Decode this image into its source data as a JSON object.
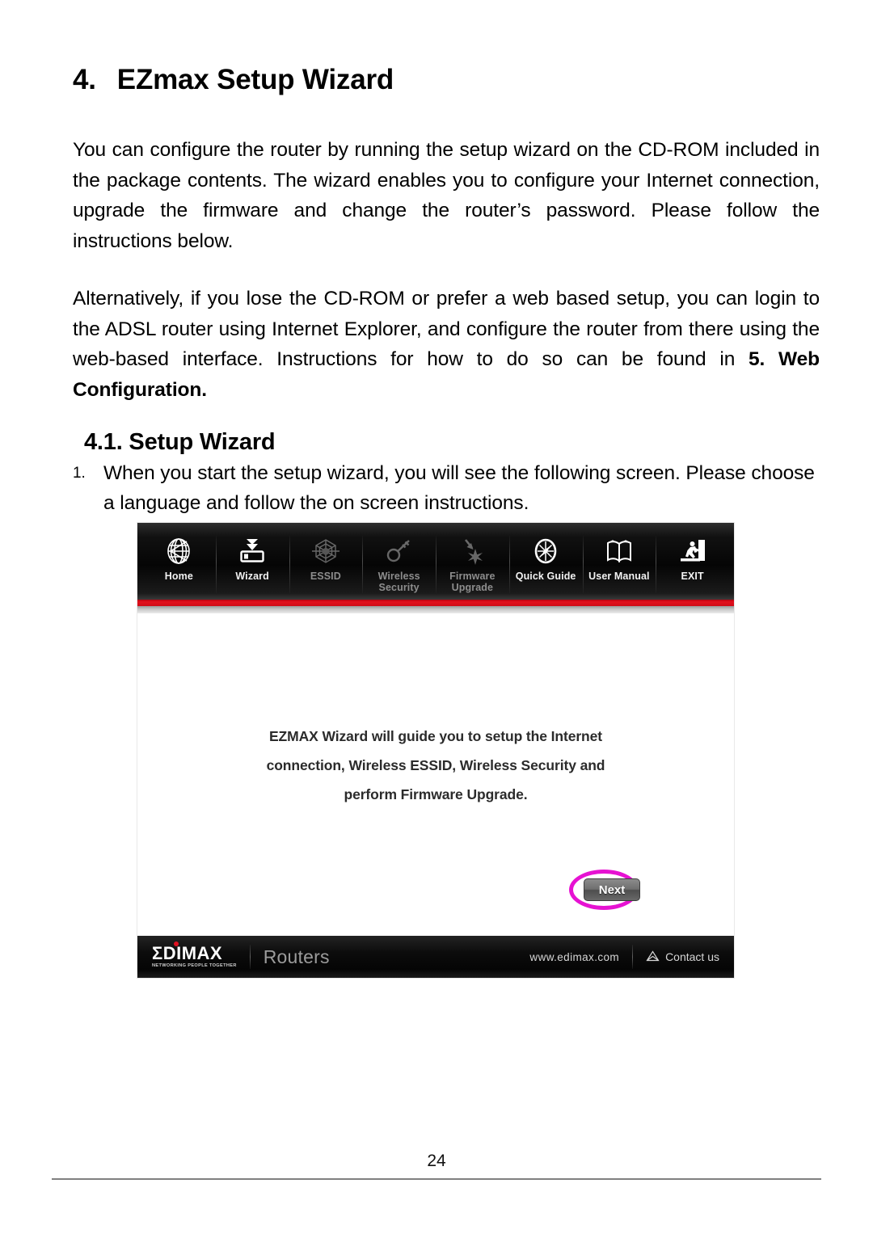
{
  "document": {
    "heading": {
      "number": "4.",
      "text": "EZmax Setup Wizard"
    },
    "paragraph_1": "You can configure the router by running the setup wizard on the CD-ROM included in the package contents. The wizard enables you to configure your Internet connection, upgrade the firmware and change the router’s password. Please follow the instructions below.",
    "paragraph_2_before": "Alternatively, if you lose the CD-ROM or prefer a web based setup, you can login to the ADSL router using Internet Explorer, and configure the router from there using the web-based interface. Instructions for how to do so can be found in ",
    "paragraph_2_bold": "5. Web Configuration.",
    "subheading": "4.1. Setup Wizard",
    "list": [
      {
        "marker": "1.",
        "text": "When you start the setup wizard, you will see the following screen. Please choose a language and follow the on screen instructions."
      }
    ],
    "page_number": "24"
  },
  "screenshot": {
    "toolbar": {
      "items": [
        {
          "label": "Home",
          "icon": "globe-icon",
          "enabled": true
        },
        {
          "label": "Wizard",
          "icon": "download-to-device-icon",
          "enabled": true
        },
        {
          "label": "ESSID",
          "icon": "wireless-web-icon",
          "enabled": false
        },
        {
          "label": "Wireless Security",
          "label_line1": "Wireless",
          "label_line2": "Security",
          "icon": "key-icon",
          "enabled": false
        },
        {
          "label": "Firmware Upgrade",
          "label_line1": "Firmware",
          "label_line2": "Upgrade",
          "icon": "firmware-arrow-burst-icon",
          "enabled": false
        },
        {
          "label": "Quick Guide",
          "icon": "compass-icon",
          "enabled": true
        },
        {
          "label": "User Manual",
          "icon": "open-book-icon",
          "enabled": true
        },
        {
          "label": "EXIT",
          "icon": "exit-running-man-icon",
          "enabled": true
        }
      ],
      "accent_color": "#d8091a"
    },
    "stage": {
      "message_line1": "EZMAX Wizard will guide you to setup the Internet",
      "message_line2": "connection, Wireless ESSID, Wireless Security and",
      "message_line3": "perform Firmware Upgrade.",
      "next_button": "Next",
      "highlight_color": "#e612d2"
    },
    "footer": {
      "brand": "ΣDIMAX",
      "tagline": "NETWORKING PEOPLE TOGETHER",
      "product": "Routers",
      "url": "www.edimax.com",
      "contact": "Contact us",
      "contact_icon": "envelope-icon"
    }
  }
}
